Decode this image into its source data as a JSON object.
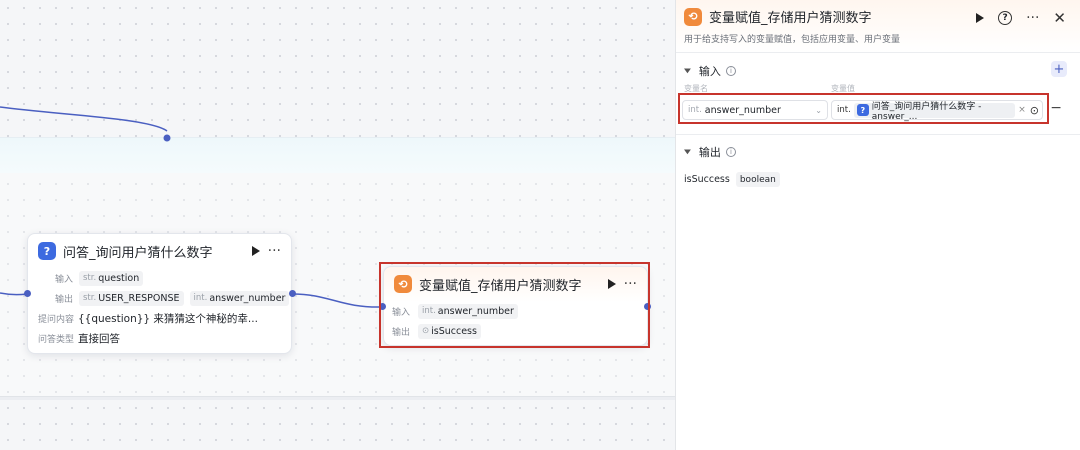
{
  "canvas": {
    "node_qa": {
      "title": "问答_询问用户猜什么数字",
      "input_label": "输入",
      "input_tags": [
        {
          "type": "str.",
          "name": "question"
        }
      ],
      "output_label": "输出",
      "output_tags": [
        {
          "type": "str.",
          "name": "USER_RESPONSE"
        },
        {
          "type": "int.",
          "name": "answer_number"
        }
      ],
      "prompt_label": "提问内容",
      "prompt_value": "{{question}} 来猜猜这个神秘的幸...",
      "answer_type_label": "问答类型",
      "answer_type_value": "直接回答"
    },
    "node_assign": {
      "title": "变量赋值_存储用户猜测数字",
      "input_label": "输入",
      "input_tag": {
        "type": "int.",
        "name": "answer_number"
      },
      "output_label": "输出",
      "output_tag": {
        "type": "⊙",
        "name": "isSuccess"
      }
    }
  },
  "panel": {
    "title": "变量赋值_存储用户猜测数字",
    "description": "用于给支持写入的变量赋值，包括应用变量、用户变量",
    "input_section": {
      "title": "输入",
      "col_name_label": "变量名",
      "col_value_label": "变量值",
      "variable": {
        "type": "int.",
        "name": "answer_number"
      },
      "value": {
        "type": "int.",
        "ref_text": "问答_询问用户猜什么数字 - answer_..."
      }
    },
    "output_section": {
      "title": "输出",
      "outputs": [
        {
          "name": "isSuccess",
          "type": "boolean"
        }
      ]
    }
  },
  "icons": {
    "qa": "question-icon",
    "assign": "variable-assign-icon",
    "colors": {
      "accent": "#4a5fc1",
      "highlight": "#c7342c",
      "orange": "#f08a3c",
      "blue": "#3d6ae0"
    }
  }
}
